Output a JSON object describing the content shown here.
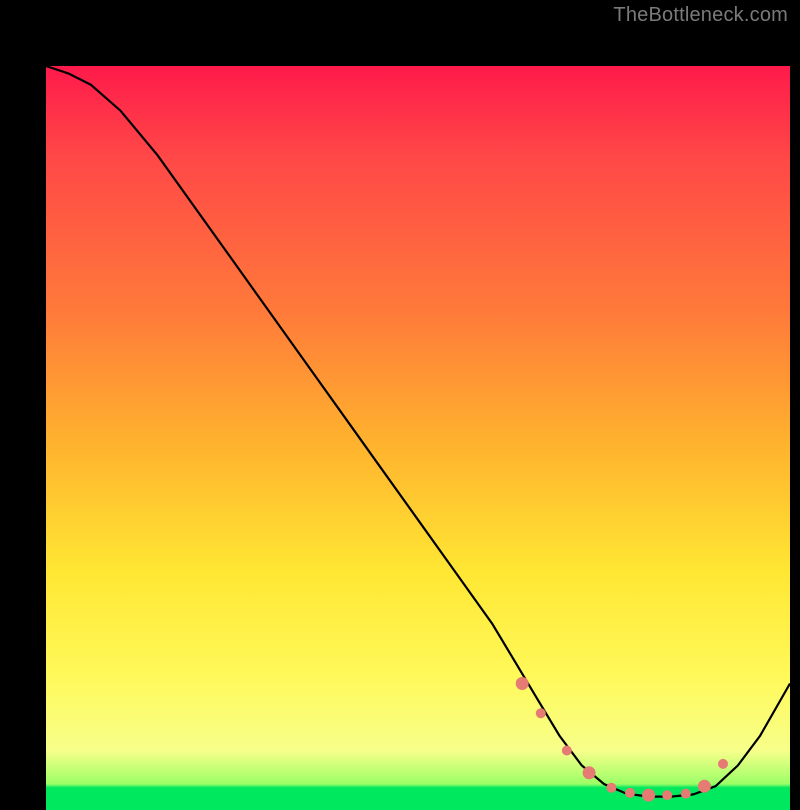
{
  "watermark": "TheBottleneck.com",
  "colors": {
    "background": "#000000",
    "curve": "#000000",
    "markers": "#e57b73",
    "gradient_top": "#ff1a4b",
    "gradient_mid1": "#ff7a3a",
    "gradient_mid2": "#ffe733",
    "gradient_low": "#f7ff8a",
    "gradient_bottom": "#00e85e"
  },
  "chart_data": {
    "type": "line",
    "title": "",
    "xlabel": "",
    "ylabel": "",
    "xlim": [
      0,
      100
    ],
    "ylim": [
      0,
      100
    ],
    "grid": false,
    "legend": false,
    "series": [
      {
        "name": "bottleneck-curve",
        "x": [
          0,
          3,
          6,
          10,
          15,
          20,
          25,
          30,
          35,
          40,
          45,
          50,
          55,
          60,
          63,
          66,
          69,
          72,
          75,
          78,
          81,
          84,
          87,
          90,
          93,
          96,
          100
        ],
        "y": [
          100,
          99,
          97.5,
          94,
          88,
          81,
          74,
          67,
          60,
          53,
          46,
          39,
          32,
          25,
          20,
          15,
          10,
          6,
          3.5,
          2.2,
          1.8,
          1.8,
          2.1,
          3.2,
          6,
          10,
          17
        ]
      }
    ],
    "markers": {
      "name": "highlight-dots",
      "x": [
        64,
        66.5,
        70,
        73,
        76,
        78.5,
        81,
        83.5,
        86,
        88.5,
        91
      ],
      "y": [
        17,
        13,
        8,
        5,
        3,
        2.3,
        2.0,
        2.0,
        2.2,
        3.2,
        6.2
      ]
    }
  }
}
